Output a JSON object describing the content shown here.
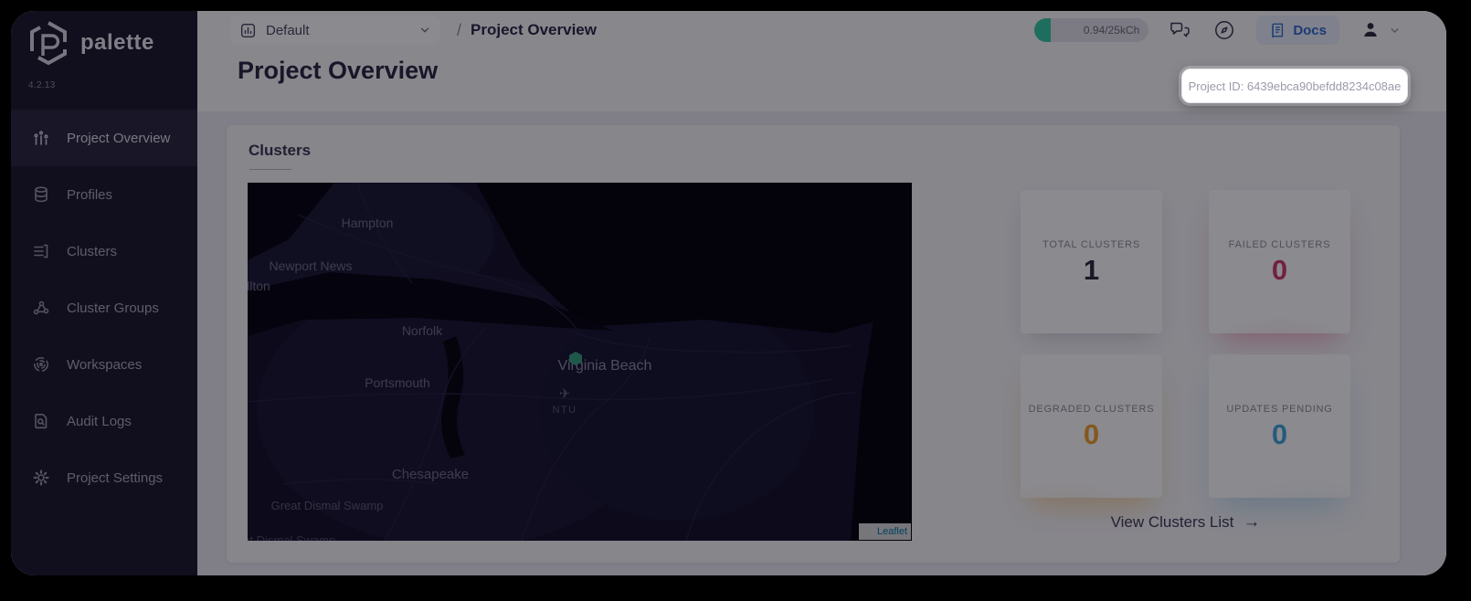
{
  "sidebar": {
    "logo_text": "palette",
    "version": "4.2.13",
    "items": [
      {
        "label": "Project Overview",
        "icon": "chart-icon",
        "active": true
      },
      {
        "label": "Profiles",
        "icon": "profiles-icon",
        "active": false
      },
      {
        "label": "Clusters",
        "icon": "clusters-icon",
        "active": false
      },
      {
        "label": "Cluster Groups",
        "icon": "cluster-groups-icon",
        "active": false
      },
      {
        "label": "Workspaces",
        "icon": "workspaces-icon",
        "active": false
      },
      {
        "label": "Audit Logs",
        "icon": "audit-logs-icon",
        "active": false
      },
      {
        "label": "Project Settings",
        "icon": "settings-icon",
        "active": false
      }
    ]
  },
  "topbar": {
    "project_selector": {
      "value": "Default"
    },
    "breadcrumb_separator": "/",
    "breadcrumb": "Project Overview",
    "usage_badge": "0.94/25kCh",
    "usage_color": "#35c7a4",
    "docs_label": "Docs",
    "docs_color": "#2f6bd0"
  },
  "page": {
    "title": "Project Overview"
  },
  "tooltip": {
    "text": "Project ID: 6439ebca90befdd8234c08ae"
  },
  "clusters_section": {
    "title": "Clusters",
    "map": {
      "labels": [
        "Hampton",
        "Newport News",
        "llton",
        "Norfolk",
        "Virginia Beach",
        "Portsmouth",
        "Chesapeake",
        "Great Dismal Swamp",
        "reat Dismal Swamp"
      ],
      "airport_code": "NTU",
      "plane_glyph": "✈",
      "marker_color": "#35a27f",
      "attribution": "Leaflet"
    },
    "stats": [
      {
        "label": "TOTAL CLUSTERS",
        "value": "1",
        "color": "#2f2c3f"
      },
      {
        "label": "FAILED CLUSTERS",
        "value": "0",
        "color": "#cf3a6a"
      },
      {
        "label": "DEGRADED CLUSTERS",
        "value": "0",
        "color": "#f0a030"
      },
      {
        "label": "UPDATES PENDING",
        "value": "0",
        "color": "#3fa7dd"
      }
    ],
    "view_link": "View Clusters List",
    "view_link_arrow": "→"
  }
}
